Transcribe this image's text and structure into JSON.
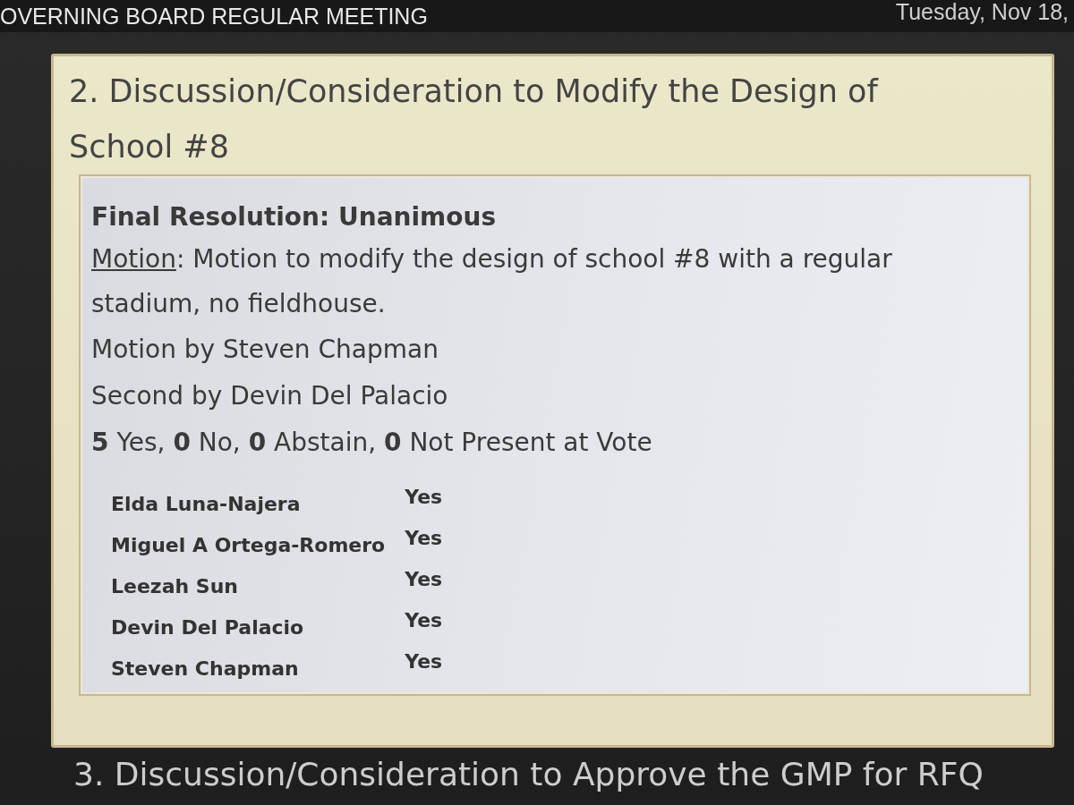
{
  "header": {
    "title": "OVERNING BOARD REGULAR MEETING",
    "date": "Tuesday, Nov 18,"
  },
  "items": [
    {
      "title": "2. Discussion/Consideration to Modify the Design of School #8",
      "resolution": {
        "heading": "Final Resolution: Unanimous",
        "motion_label": "Motion",
        "motion_text": ": Motion to modify the design of school #8 with a regular stadium, no fieldhouse.",
        "motion_by": "Motion by Steven Chapman",
        "second_by": "Second by Devin Del Palacio",
        "tally": "**5** Yes, **0** No, **0** Abstain, **0** Not Present at Vote",
        "votes": [
          {
            "name": "Elda Luna-Najera",
            "vote": "Yes"
          },
          {
            "name": "Miguel A Ortega-Romero",
            "vote": "Yes"
          },
          {
            "name": "Leezah Sun",
            "vote": "Yes"
          },
          {
            "name": "Devin Del Palacio",
            "vote": "Yes"
          },
          {
            "name": "Steven Chapman",
            "vote": "Yes"
          }
        ]
      }
    },
    {
      "title": "3. Discussion/Consideration to Approve the GMP for RFQ"
    }
  ]
}
